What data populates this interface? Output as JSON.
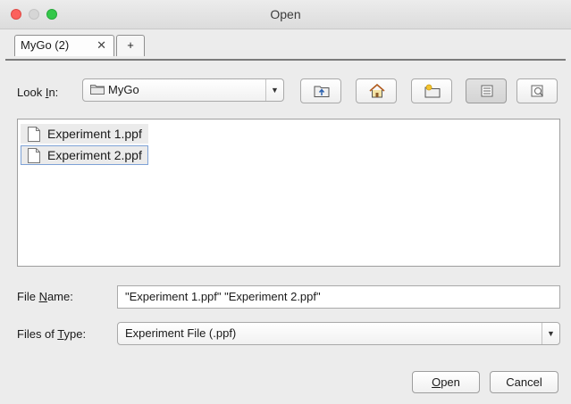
{
  "window": {
    "title": "Open"
  },
  "tabs": [
    {
      "label": "MyGo (2)",
      "close_glyph": "✕"
    },
    {
      "label": "+"
    }
  ],
  "look_in": {
    "label_pre": "Look ",
    "label_mnemonic": "I",
    "label_post": "n:",
    "value": "MyGo",
    "icon": "folder-icon"
  },
  "toolbar": {
    "buttons": [
      {
        "name": "up-folder-button",
        "icon": "up-folder-icon"
      },
      {
        "name": "home-button",
        "icon": "home-icon"
      },
      {
        "name": "new-folder-button",
        "icon": "new-folder-icon"
      },
      {
        "name": "list-view-button",
        "icon": "list-view-icon",
        "pressed": true
      },
      {
        "name": "details-view-button",
        "icon": "details-view-icon"
      }
    ]
  },
  "files": [
    {
      "name": "Experiment 1.ppf",
      "selected": true
    },
    {
      "name": "Experiment 2.ppf",
      "selected": true,
      "focused": true
    }
  ],
  "file_name": {
    "label_pre": "File ",
    "label_mnemonic": "N",
    "label_post": "ame:",
    "value": "\"Experiment 1.ppf\" \"Experiment 2.ppf\""
  },
  "file_type": {
    "label_pre": "Files of ",
    "label_mnemonic": "T",
    "label_post": "ype:",
    "value": "Experiment File (.ppf)"
  },
  "buttons": {
    "open_mnemonic": "O",
    "open_rest": "pen",
    "cancel": "Cancel"
  },
  "colors": {
    "close": "#fc615d",
    "minimize": "#d6d6d6",
    "maximize": "#34c84a",
    "selection": "#ebebeb",
    "focus_border": "#7ea2d6"
  }
}
